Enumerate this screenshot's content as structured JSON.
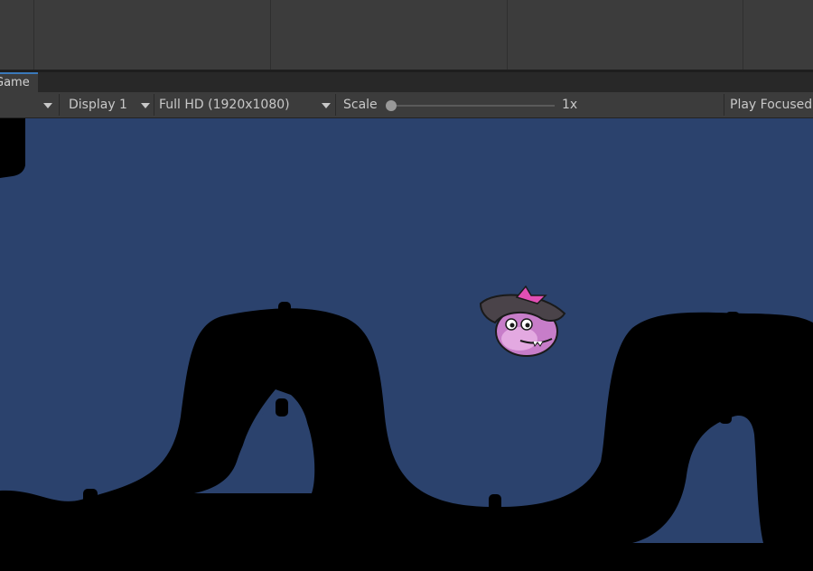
{
  "game_tab": {
    "label": "Game"
  },
  "game_toolbar": {
    "display": "Display 1",
    "resolution": "Full HD (1920x1080)",
    "scale_label": "Scale",
    "scale_value": "1x",
    "play_mode": "Play Focused"
  },
  "colors": {
    "editor_bg": "#3c3c3c",
    "tab_accent": "#3a79bb",
    "game_background": "#2b426d",
    "terrain": "#000000"
  },
  "icons": [
    "chevron-down-icon",
    "slider-knob"
  ]
}
